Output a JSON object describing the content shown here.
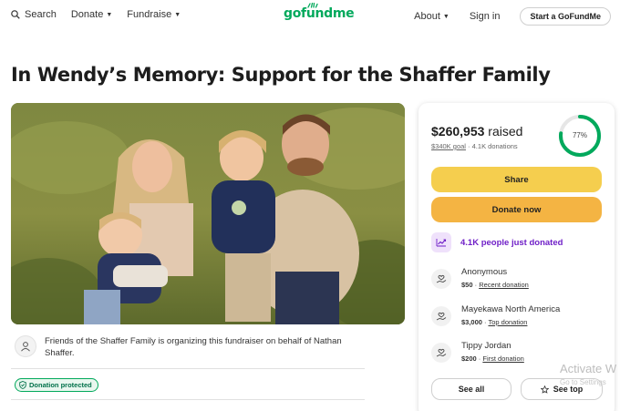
{
  "header": {
    "search_label": "Search",
    "donate_label": "Donate",
    "fundraise_label": "Fundraise",
    "logo_text": "gofundme",
    "about_label": "About",
    "signin_label": "Sign in",
    "start_label": "Start a GoFundMe"
  },
  "campaign": {
    "title": "In Wendy’s Memory: Support for the Shaffer Family",
    "organizer_text": "Friends of the Shaffer Family is organizing this fundraiser on behalf of Nathan Shaffer.",
    "badge_label": "Donation protected"
  },
  "donation": {
    "raised_amount": "$260,953",
    "raised_word": "raised",
    "goal": "$340K goal",
    "separator": "·",
    "donation_count": "4.1K donations",
    "progress_label": "77%",
    "progress_fraction": 0.77,
    "share_label": "Share",
    "donate_label": "Donate now",
    "trend_text": "4.1K people just donated",
    "donors": [
      {
        "name": "Anonymous",
        "amount": "$50",
        "type": "Recent donation"
      },
      {
        "name": "Mayekawa North America",
        "amount": "$3,000",
        "type": "Top donation"
      },
      {
        "name": "Tippy Jordan",
        "amount": "$200",
        "type": "First donation"
      }
    ],
    "see_all_label": "See all",
    "see_top_label": "See top"
  },
  "overlay": {
    "activate_title": "Activate W",
    "activate_sub": "Go to Settings"
  },
  "colors": {
    "brand_green": "#02a95c",
    "share_yellow": "#f5ce4e",
    "donate_orange": "#f4b443",
    "trend_purple": "#6f1fc7"
  }
}
